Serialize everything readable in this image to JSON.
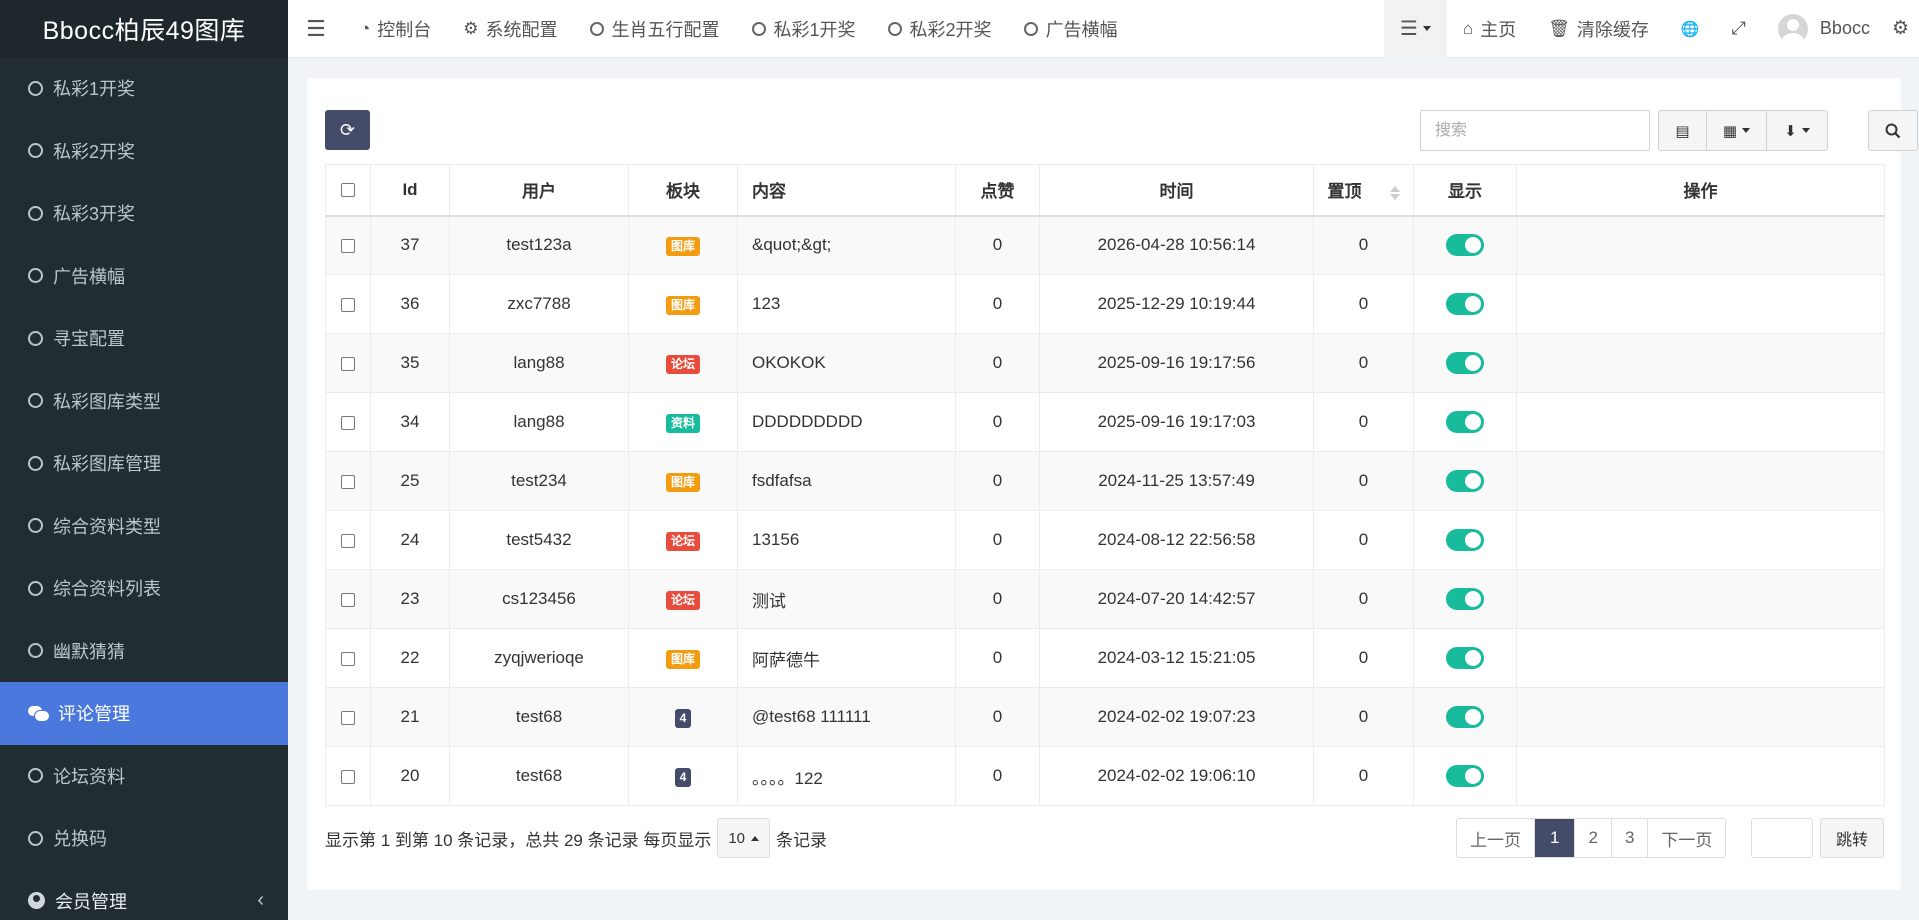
{
  "app": {
    "title": "Bbocc柏辰49图库"
  },
  "sidebar": {
    "items": [
      {
        "label": "私彩1开奖"
      },
      {
        "label": "私彩2开奖"
      },
      {
        "label": "私彩3开奖"
      },
      {
        "label": "广告横幅"
      },
      {
        "label": "寻宝配置"
      },
      {
        "label": "私彩图库类型"
      },
      {
        "label": "私彩图库管理"
      },
      {
        "label": "综合资料类型"
      },
      {
        "label": "综合资料列表"
      },
      {
        "label": "幽默猜猜"
      },
      {
        "label": "评论管理",
        "active": true
      },
      {
        "label": "论坛资料"
      },
      {
        "label": "兑换码"
      }
    ],
    "group": {
      "label": "会员管理"
    }
  },
  "topnav": {
    "tabs": [
      {
        "label": "控制台",
        "icon": "dashboard-icon"
      },
      {
        "label": "系统配置",
        "icon": "gear-icon"
      },
      {
        "label": "生肖五行配置",
        "icon": "circle-icon"
      },
      {
        "label": "私彩1开奖",
        "icon": "circle-icon"
      },
      {
        "label": "私彩2开奖",
        "icon": "circle-icon"
      },
      {
        "label": "广告横幅",
        "icon": "circle-icon"
      }
    ],
    "home": "主页",
    "clear_cache": "清除缓存",
    "username": "Bbocc"
  },
  "toolbar": {
    "search_placeholder": "搜索"
  },
  "table": {
    "headers": {
      "id": "Id",
      "user": "用户",
      "section": "板块",
      "content": "内容",
      "likes": "点赞",
      "time": "时间",
      "top": "置顶",
      "show": "显示",
      "ops": "操作"
    },
    "rows": [
      {
        "id": "37",
        "user": "test123a",
        "badge": "图库",
        "badge_color": "#f39c12",
        "content": "&quot;&gt;",
        "likes": "0",
        "time": "2026-04-28 10:56:14",
        "top": "0"
      },
      {
        "id": "36",
        "user": "zxc7788",
        "badge": "图库",
        "badge_color": "#f39c12",
        "content": "123",
        "likes": "0",
        "time": "2025-12-29 10:19:44",
        "top": "0"
      },
      {
        "id": "35",
        "user": "lang88",
        "badge": "论坛",
        "badge_color": "#e74c3c",
        "content": "OKOKOK",
        "likes": "0",
        "time": "2025-09-16 19:17:56",
        "top": "0"
      },
      {
        "id": "34",
        "user": "lang88",
        "badge": "资料",
        "badge_color": "#18bc9c",
        "content": "DDDDDDDDD",
        "likes": "0",
        "time": "2025-09-16 19:17:03",
        "top": "0"
      },
      {
        "id": "25",
        "user": "test234",
        "badge": "图库",
        "badge_color": "#f39c12",
        "content": "fsdfafsa",
        "likes": "0",
        "time": "2024-11-25 13:57:49",
        "top": "0"
      },
      {
        "id": "24",
        "user": "test5432",
        "badge": "论坛",
        "badge_color": "#e74c3c",
        "content": "13156",
        "likes": "0",
        "time": "2024-08-12 22:56:58",
        "top": "0"
      },
      {
        "id": "23",
        "user": "cs123456",
        "badge": "论坛",
        "badge_color": "#e74c3c",
        "content": "测试",
        "likes": "0",
        "time": "2024-07-20 14:42:57",
        "top": "0"
      },
      {
        "id": "22",
        "user": "zyqjwerioqe",
        "badge": "图库",
        "badge_color": "#f39c12",
        "content": "阿萨德牛",
        "likes": "0",
        "time": "2024-03-12 15:21:05",
        "top": "0"
      },
      {
        "id": "21",
        "user": "test68",
        "badge": "4",
        "badge_color": "#444c69",
        "content": "@test68 111111",
        "likes": "0",
        "time": "2024-02-02 19:07:23",
        "top": "0"
      },
      {
        "id": "20",
        "user": "test68",
        "badge": "4",
        "badge_color": "#444c69",
        "content": "。。。。122",
        "likes": "0",
        "time": "2024-02-02 19:06:10",
        "top": "0"
      }
    ]
  },
  "footer": {
    "info_prefix": "显示第 1 到第 10 条记录，总共 29 条记录 每页显示",
    "page_size": "10",
    "info_suffix": "条记录",
    "prev": "上一页",
    "pages": [
      "1",
      "2",
      "3"
    ],
    "current_page": "1",
    "next": "下一页",
    "jump": "跳转"
  },
  "colors": {
    "accent": "#4a78dc",
    "primary": "#444c69",
    "success": "#18bc9c",
    "sidebar_bg": "#222d32"
  }
}
